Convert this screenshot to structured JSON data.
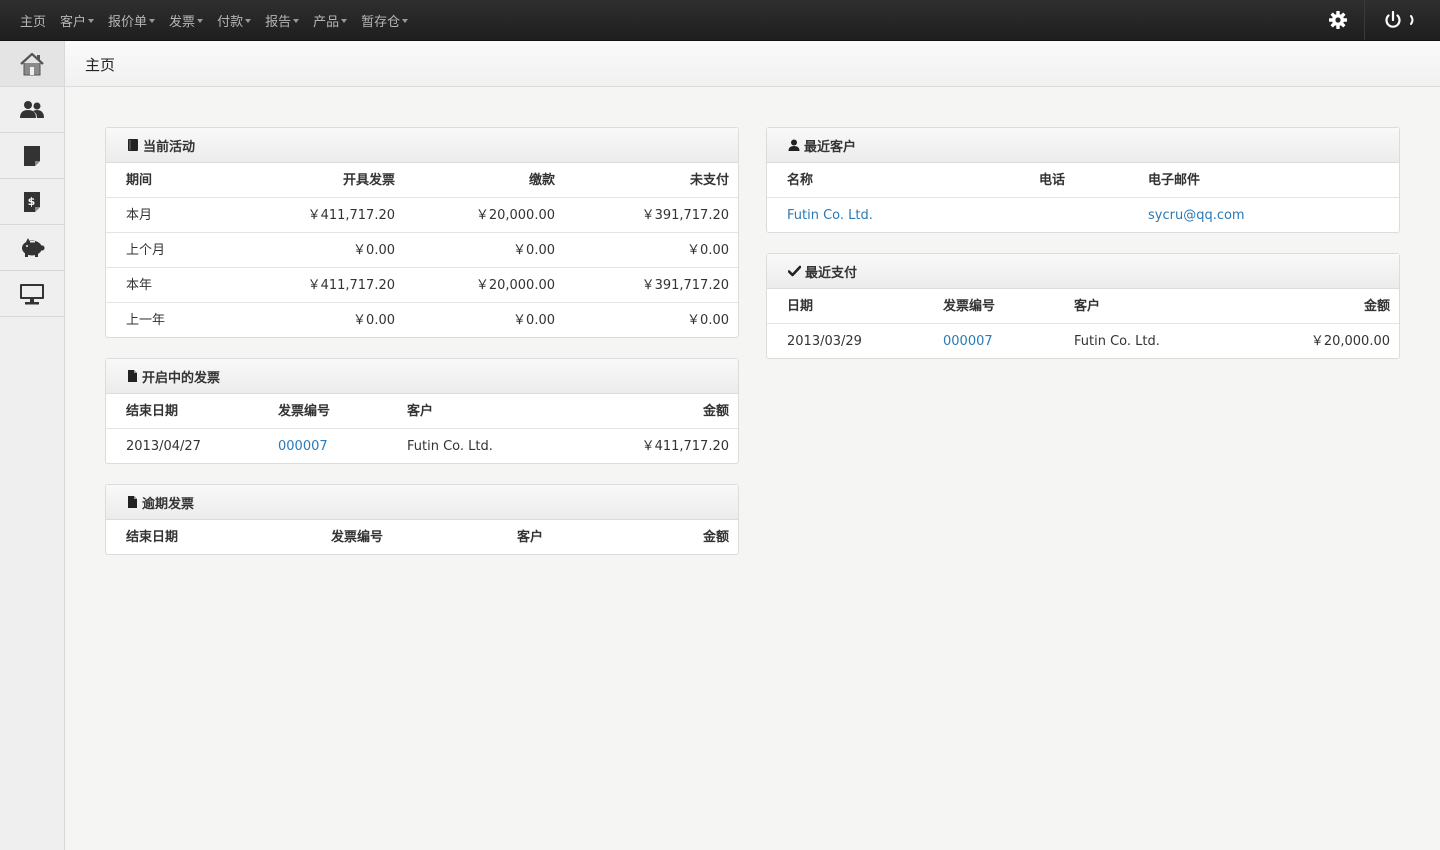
{
  "nav": {
    "items": [
      {
        "label": "主页",
        "caret": false
      },
      {
        "label": "客户",
        "caret": true
      },
      {
        "label": "报价单",
        "caret": true
      },
      {
        "label": "发票",
        "caret": true
      },
      {
        "label": "付款",
        "caret": true
      },
      {
        "label": "报告",
        "caret": true
      },
      {
        "label": "产品",
        "caret": true
      },
      {
        "label": "暂存仓",
        "caret": true
      }
    ],
    "icons": [
      "gear-icon",
      "power-icon"
    ]
  },
  "sidebar": {
    "icons": [
      "home-icon",
      "users-icon",
      "invoice-icon",
      "payment-icon",
      "piggy-bank-icon",
      "monitor-icon"
    ]
  },
  "page": {
    "title": "主页"
  },
  "activity": {
    "title": "当前活动",
    "headers": [
      "期间",
      "开具发票",
      "缴款",
      "未支付"
    ],
    "rows": [
      [
        "本月",
        "￥411,717.20",
        "￥20,000.00",
        "￥391,717.20"
      ],
      [
        "上个月",
        "￥0.00",
        "￥0.00",
        "￥0.00"
      ],
      [
        "本年",
        "￥411,717.20",
        "￥20,000.00",
        "￥391,717.20"
      ],
      [
        "上一年",
        "￥0.00",
        "￥0.00",
        "￥0.00"
      ]
    ]
  },
  "open_invoices": {
    "title": "开启中的发票",
    "headers": [
      "结束日期",
      "发票编号",
      "客户",
      "金额"
    ],
    "rows": [
      [
        "2013/04/27",
        "000007",
        "Futin Co. Ltd.",
        "￥411,717.20"
      ]
    ]
  },
  "overdue": {
    "title": "逾期发票",
    "headers": [
      "结束日期",
      "发票编号",
      "客户",
      "金额"
    ]
  },
  "recent_clients": {
    "title": "最近客户",
    "headers": [
      "名称",
      "电话",
      "电子邮件"
    ],
    "rows": [
      [
        "Futin Co. Ltd.",
        "",
        "sycru@qq.com"
      ]
    ]
  },
  "recent_payments": {
    "title": "最近支付",
    "headers": [
      "日期",
      "发票编号",
      "客户",
      "金额"
    ],
    "rows": [
      [
        "2013/03/29",
        "000007",
        "Futin Co. Ltd.",
        "￥20,000.00"
      ]
    ]
  }
}
